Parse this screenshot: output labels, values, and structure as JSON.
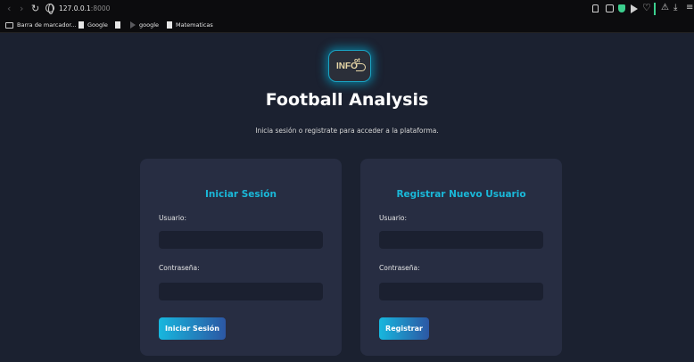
{
  "browser": {
    "url_host": "127.0.0.1",
    "url_port": ":8000",
    "bookmarks": [
      {
        "label": "Barra de marcador...",
        "icon": "folder-icon"
      },
      {
        "label": "Google",
        "icon": "page-icon"
      },
      {
        "label": "",
        "icon": "page-icon"
      },
      {
        "label": "google",
        "icon": "favicon-icon"
      },
      {
        "label": "Matematicas",
        "icon": "page-icon"
      }
    ]
  },
  "logo": {
    "text": "INFO",
    "sup": "ot"
  },
  "page": {
    "title": "Football Analysis",
    "subtitle": "Inicia sesión o registrate para acceder a la plataforma."
  },
  "login": {
    "title": "Iniciar Sesión",
    "user_label": "Usuario:",
    "user_value": "",
    "password_label": "Contraseña:",
    "password_value": "",
    "button": "Iniciar Sesión"
  },
  "register": {
    "title": "Registrar Nuevo Usuario",
    "user_label": "Usuario:",
    "user_value": "",
    "password_label": "Contraseña:",
    "password_value": "",
    "button": "Registrar"
  },
  "colors": {
    "background": "#1b2130",
    "card": "#272d42",
    "accent": "#1ab8d8",
    "button_start": "#17b7de",
    "button_end": "#2c57a4"
  }
}
